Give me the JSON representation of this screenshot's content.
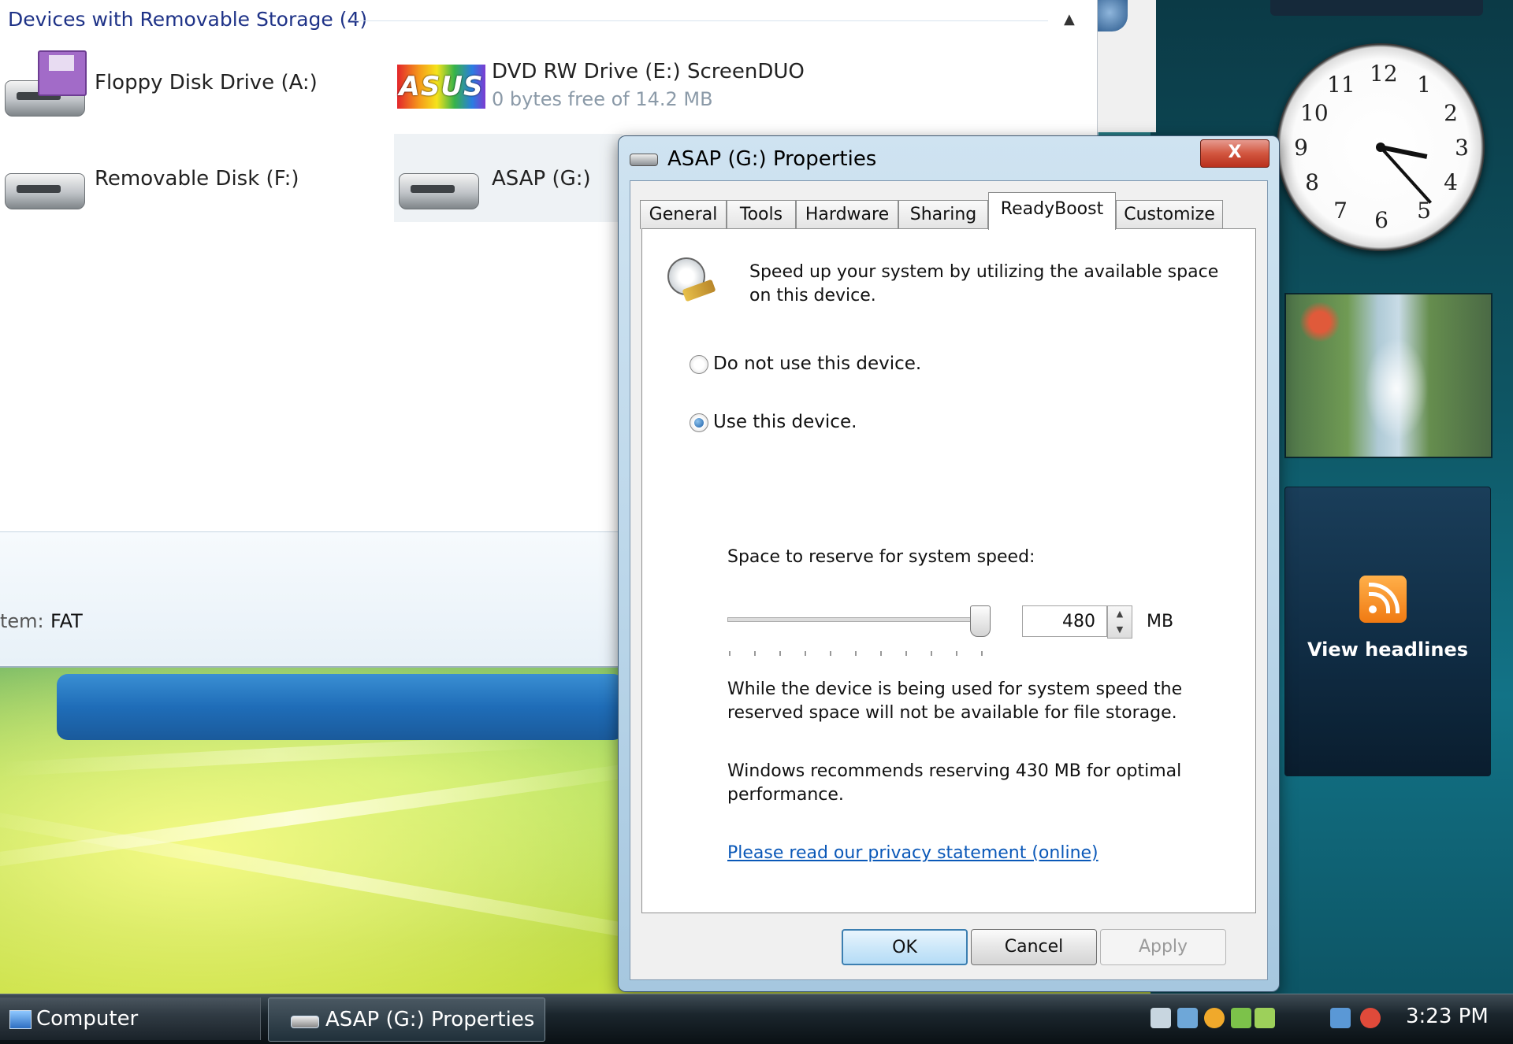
{
  "explorer": {
    "group_header": "Devices with Removable Storage (4)",
    "devices": [
      {
        "name": "Floppy Disk Drive (A:)",
        "detail": ""
      },
      {
        "name": "DVD RW Drive (E:) ScreenDUO",
        "detail": "0 bytes free of 14.2 MB",
        "logo_text": "ASUS"
      },
      {
        "name": "Removable Disk (F:)",
        "detail": ""
      },
      {
        "name": "ASAP (G:)",
        "detail": ""
      }
    ],
    "details_label": "tem:",
    "details_value": "FAT"
  },
  "dialog": {
    "title": "ASAP (G:) Properties",
    "close_label": "X",
    "tabs": [
      {
        "label": "General"
      },
      {
        "label": "Tools"
      },
      {
        "label": "Hardware"
      },
      {
        "label": "Sharing"
      },
      {
        "label": "ReadyBoost",
        "active": true
      },
      {
        "label": "Customize"
      }
    ],
    "readyboost": {
      "intro": "Speed up your system by utilizing the available space on this device.",
      "option_no": "Do not use this device.",
      "option_yes": "Use this device.",
      "selected_option": "Use this device.",
      "reserve_label": "Space to reserve for system speed:",
      "reserve_value": "480",
      "reserve_unit": "MB",
      "slider_level": 0.97,
      "note": "While the device is being used for system speed the reserved space will not be available for file storage.",
      "recommendation": "Windows recommends reserving 430 MB for optimal performance.",
      "privacy_link": "Please read our privacy statement (online)"
    },
    "buttons": {
      "ok": "OK",
      "cancel": "Cancel",
      "apply": "Apply"
    }
  },
  "gadgets": {
    "clock": {
      "time": "3:23",
      "numerals": [
        "12",
        "1",
        "2",
        "3",
        "4",
        "5",
        "6",
        "7",
        "8",
        "9",
        "10",
        "11"
      ]
    },
    "feed_label": "View headlines"
  },
  "taskbar": {
    "items": [
      {
        "label": "Computer"
      },
      {
        "label": "ASAP (G:) Properties",
        "active": true
      }
    ],
    "time": "3:23 PM"
  },
  "colors": {
    "link": "#0a58b8",
    "group_header": "#1e3287",
    "close_button": "#c8412a",
    "default_button_border": "#3c7fb1"
  }
}
